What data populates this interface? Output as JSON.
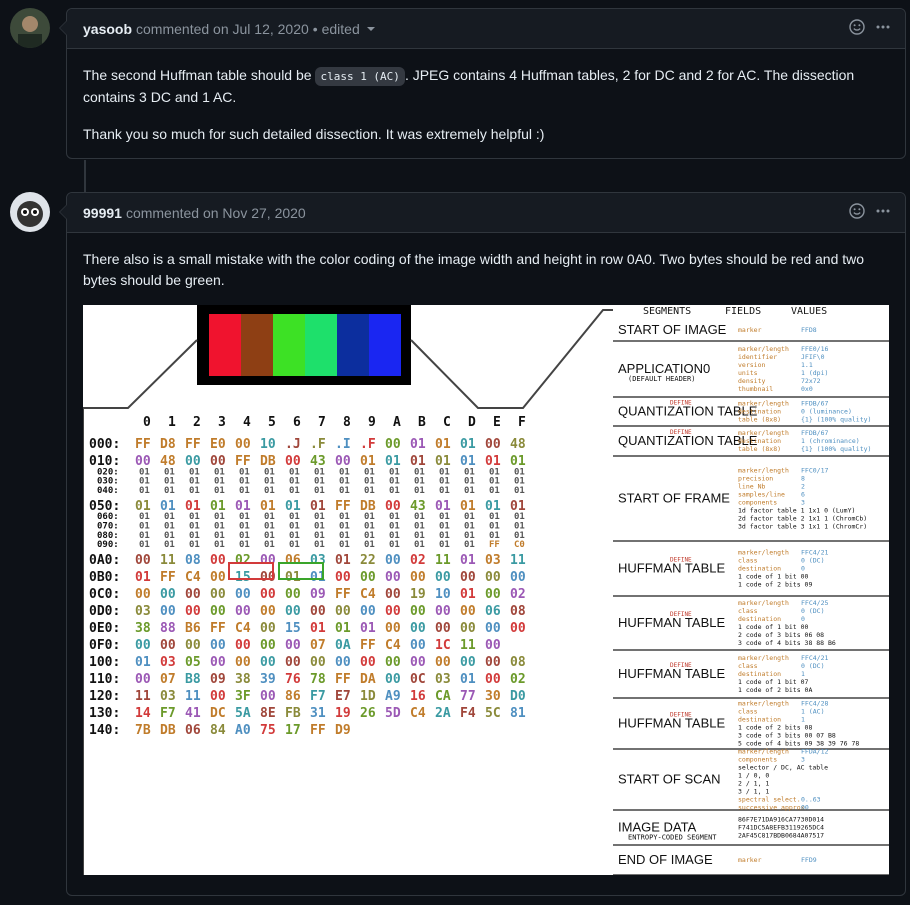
{
  "comments": [
    {
      "author": "yasoob",
      "meta": "commented on Jul 12, 2020",
      "edited": "• edited",
      "body_pre": "The second Huffman table should be ",
      "code": "class 1 (AC)",
      "body_post": ". JPEG contains 4 Huffman tables, 2 for DC and 2 for AC. The dissection contains 3 DC and 1 AC.",
      "body2": "Thank you so much for such detailed dissection. It was extremely helpful :)"
    },
    {
      "author": "99991",
      "meta": "commented on Nov 27, 2020",
      "body": "There also is a small mistake with the color coding of the image width and height in row 0A0. Two bytes should be red and two bytes should be green."
    }
  ],
  "icons": {
    "reaction": "smiley-icon",
    "menu": "kebab-icon"
  },
  "figure": {
    "headers": {
      "segments": "SEGMENTS",
      "fields": "FIELDS",
      "values": "VALUES"
    },
    "swatches": [
      "#f0132e",
      "#8e3f14",
      "#3de125",
      "#1ee06b",
      "#0c2e9e",
      "#1a26f2"
    ],
    "col_header": [
      "0",
      "1",
      "2",
      "3",
      "4",
      "5",
      "6",
      "7",
      "8",
      "9",
      "A",
      "B",
      "C",
      "D",
      "E",
      "F"
    ],
    "rows": [
      {
        "a": "000:",
        "b": [
          "FF",
          "D8",
          "FF",
          "E0",
          "00",
          "10",
          ".J",
          ".F",
          ".I",
          ".F",
          "00",
          "01",
          "01",
          "01",
          "00",
          "48"
        ],
        "big": true
      },
      {
        "a": "010:",
        "b": [
          "00",
          "48",
          "00",
          "00",
          "FF",
          "DB",
          "00",
          "43",
          "00",
          "01",
          "01",
          "01",
          "01",
          "01",
          "01",
          "01"
        ],
        "big": true
      },
      {
        "a": "020:",
        "b": [
          "01",
          "01",
          "01",
          "01",
          "01",
          "01",
          "01",
          "01",
          "01",
          "01",
          "01",
          "01",
          "01",
          "01",
          "01",
          "01"
        ],
        "big": false
      },
      {
        "a": "030:",
        "b": [
          "01",
          "01",
          "01",
          "01",
          "01",
          "01",
          "01",
          "01",
          "01",
          "01",
          "01",
          "01",
          "01",
          "01",
          "01",
          "01"
        ],
        "big": false
      },
      {
        "a": "040:",
        "b": [
          "01",
          "01",
          "01",
          "01",
          "01",
          "01",
          "01",
          "01",
          "01",
          "01",
          "01",
          "01",
          "01",
          "01",
          "01",
          "01"
        ],
        "big": false
      },
      {
        "a": "050:",
        "b": [
          "01",
          "01",
          "01",
          "01",
          "01",
          "01",
          "01",
          "01",
          "FF",
          "DB",
          "00",
          "43",
          "01",
          "01",
          "01",
          "01"
        ],
        "big": true
      },
      {
        "a": "060:",
        "b": [
          "01",
          "01",
          "01",
          "01",
          "01",
          "01",
          "01",
          "01",
          "01",
          "01",
          "01",
          "01",
          "01",
          "01",
          "01",
          "01"
        ],
        "big": false
      },
      {
        "a": "070:",
        "b": [
          "01",
          "01",
          "01",
          "01",
          "01",
          "01",
          "01",
          "01",
          "01",
          "01",
          "01",
          "01",
          "01",
          "01",
          "01",
          "01"
        ],
        "big": false
      },
      {
        "a": "080:",
        "b": [
          "01",
          "01",
          "01",
          "01",
          "01",
          "01",
          "01",
          "01",
          "01",
          "01",
          "01",
          "01",
          "01",
          "01",
          "01",
          "01"
        ],
        "big": false
      },
      {
        "a": "090:",
        "b": [
          "01",
          "01",
          "01",
          "01",
          "01",
          "01",
          "01",
          "01",
          "01",
          "01",
          "01",
          "01",
          "01",
          "01",
          "FF",
          "C0"
        ],
        "big": false
      },
      {
        "a": "0A0:",
        "b": [
          "00",
          "11",
          "08",
          "00",
          "02",
          "00",
          "06",
          "03",
          "01",
          "22",
          "00",
          "02",
          "11",
          "01",
          "03",
          "11"
        ],
        "big": true
      },
      {
        "a": "0B0:",
        "b": [
          "01",
          "FF",
          "C4",
          "00",
          "15",
          "00",
          "01",
          "01",
          "00",
          "00",
          "00",
          "00",
          "00",
          "00",
          "00",
          "00"
        ],
        "big": true
      },
      {
        "a": "0C0:",
        "b": [
          "00",
          "00",
          "00",
          "00",
          "00",
          "00",
          "00",
          "09",
          "FF",
          "C4",
          "00",
          "19",
          "10",
          "01",
          "00",
          "02"
        ],
        "big": true
      },
      {
        "a": "0D0:",
        "b": [
          "03",
          "00",
          "00",
          "00",
          "00",
          "00",
          "00",
          "00",
          "00",
          "00",
          "00",
          "00",
          "00",
          "00",
          "06",
          "08"
        ],
        "big": true
      },
      {
        "a": "0E0:",
        "b": [
          "38",
          "88",
          "B6",
          "FF",
          "C4",
          "00",
          "15",
          "01",
          "01",
          "01",
          "00",
          "00",
          "00",
          "00",
          "00",
          "00"
        ],
        "big": true
      },
      {
        "a": "0F0:",
        "b": [
          "00",
          "00",
          "00",
          "00",
          "00",
          "00",
          "00",
          "07",
          "0A",
          "FF",
          "C4",
          "00",
          "1C",
          "11",
          "00",
          ""
        ],
        "big": true
      },
      {
        "a": "100:",
        "b": [
          "01",
          "03",
          "05",
          "00",
          "00",
          "00",
          "00",
          "00",
          "00",
          "00",
          "00",
          "00",
          "00",
          "00",
          "00",
          "08"
        ],
        "big": true
      },
      {
        "a": "110:",
        "b": [
          "00",
          "07",
          "B8",
          "09",
          "38",
          "39",
          "76",
          "78",
          "FF",
          "DA",
          "00",
          "0C",
          "03",
          "01",
          "00",
          "02"
        ],
        "big": true
      },
      {
        "a": "120:",
        "b": [
          "11",
          "03",
          "11",
          "00",
          "3F",
          "00",
          "86",
          "F7",
          "E7",
          "1D",
          "A9",
          "16",
          "CA",
          "77",
          "30",
          "D0"
        ],
        "big": true
      },
      {
        "a": "130:",
        "b": [
          "14",
          "F7",
          "41",
          "DC",
          "5A",
          "8E",
          "FB",
          "31",
          "19",
          "26",
          "5D",
          "C4",
          "2A",
          "F4",
          "5C",
          "81"
        ],
        "big": true
      },
      {
        "a": "140:",
        "b": [
          "7B",
          "DB",
          "06",
          "84",
          "A0",
          "75",
          "17",
          "FF",
          "D9",
          "",
          "",
          "",
          "",
          "",
          "",
          ""
        ],
        "big": true
      }
    ],
    "segments": [
      {
        "name": "START OF IMAGE",
        "fields": [
          {
            "f": "marker",
            "v": "FFD8"
          }
        ]
      },
      {
        "pre": "",
        "name": "APPLICATION0",
        "sub": "(DEFAULT HEADER)",
        "fields": [
          {
            "f": "marker/length",
            "v": "FFE0/16"
          },
          {
            "f": "identifier",
            "v": "JFIF\\0"
          },
          {
            "f": "version",
            "v": "1.1"
          },
          {
            "f": "units",
            "v": "1 (dpi)"
          },
          {
            "f": "density",
            "v": "72x72"
          },
          {
            "f": "thumbnail",
            "v": "0x0"
          }
        ]
      },
      {
        "pre": "DEFINE",
        "name": "QUANTIZATION TABLE",
        "fields": [
          {
            "f": "marker/length",
            "v": "FFDB/67"
          },
          {
            "f": "destination",
            "v": "0 (luminance)"
          },
          {
            "f": "table (8x8)",
            "v": "{1} (100% quality)"
          }
        ]
      },
      {
        "pre": "DEFINE",
        "name": "QUANTIZATION TABLE",
        "fields": [
          {
            "f": "marker/length",
            "v": "FFDB/67"
          },
          {
            "f": "destination",
            "v": "1 (chrominance)"
          },
          {
            "f": "table (8x8)",
            "v": "{1} (100% quality)"
          }
        ]
      },
      {
        "name": "START OF FRAME",
        "fields": [
          {
            "f": "marker/length",
            "v": "FFC0/17"
          },
          {
            "f": "precision",
            "v": "8"
          },
          {
            "f": "line Nb",
            "v": "2"
          },
          {
            "f": "samples/line",
            "v": "6"
          },
          {
            "f": "components",
            "v": "3"
          },
          {
            "f": "",
            "v": "1d factor table 1 1x1 0 (LumY)"
          },
          {
            "f": "",
            "v": "2d factor table 2 1x1 1 (ChromCb)"
          },
          {
            "f": "",
            "v": "3d factor table 3 1x1 1 (ChromCr)"
          }
        ]
      },
      {
        "pre": "DEFINE",
        "name": "HUFFMAN TABLE",
        "fields": [
          {
            "f": "marker/length",
            "v": "FFC4/21"
          },
          {
            "f": "class",
            "v": "0 (DC)"
          },
          {
            "f": "destination",
            "v": "0"
          },
          {
            "f": "",
            "v": "1 code of 1 bit 00"
          },
          {
            "f": "",
            "v": "1 code of 2 bits 09"
          }
        ]
      },
      {
        "pre": "DEFINE",
        "name": "HUFFMAN TABLE",
        "fields": [
          {
            "f": "marker/length",
            "v": "FFC4/25"
          },
          {
            "f": "class",
            "v": "0 (DC)"
          },
          {
            "f": "destination",
            "v": "0"
          },
          {
            "f": "",
            "v": "1 code of 1 bit 00"
          },
          {
            "f": "",
            "v": "2 code of 3 bits 06 08"
          },
          {
            "f": "",
            "v": "3 code of 4 bits 38 88 B6"
          }
        ]
      },
      {
        "pre": "DEFINE",
        "name": "HUFFMAN TABLE",
        "fields": [
          {
            "f": "marker/length",
            "v": "FFC4/21"
          },
          {
            "f": "class",
            "v": "0 (DC)"
          },
          {
            "f": "destination",
            "v": "1"
          },
          {
            "f": "",
            "v": "1 code of 1 bit 07"
          },
          {
            "f": "",
            "v": "1 code of 2 bits 0A"
          }
        ]
      },
      {
        "pre": "DEFINE",
        "name": "HUFFMAN TABLE",
        "fields": [
          {
            "f": "marker/length",
            "v": "FFC4/28"
          },
          {
            "f": "class",
            "v": "1 (AC)"
          },
          {
            "f": "destination",
            "v": "1"
          },
          {
            "f": "",
            "v": "1 code of 2 bits 08"
          },
          {
            "f": "",
            "v": "3 code of 3 bits 00 07 B8"
          },
          {
            "f": "",
            "v": "5 code of 4 bits 09 38 39 76 78"
          }
        ]
      },
      {
        "name": "START OF SCAN",
        "fields": [
          {
            "f": "marker/length",
            "v": "FFDA/12"
          },
          {
            "f": "components",
            "v": "3"
          },
          {
            "f": "",
            "v": "selector / DC, AC table"
          },
          {
            "f": "",
            "v": "1 / 0, 0"
          },
          {
            "f": "",
            "v": "2 / 1, 1"
          },
          {
            "f": "",
            "v": "3 / 1, 1"
          },
          {
            "f": "spectral select.",
            "v": "0..63"
          },
          {
            "f": "successive approx.",
            "v": "00"
          }
        ]
      },
      {
        "name": "IMAGE DATA",
        "sub": "ENTROPY-CODED SEGMENT",
        "fields": [
          {
            "f": "",
            "v": "86F7E71DA916CA7730D014"
          },
          {
            "f": "",
            "v": "F741DC5A8EFB3119265DC4"
          },
          {
            "f": "",
            "v": "2AF45C817BDB0684A07517"
          }
        ]
      },
      {
        "name": "END OF IMAGE",
        "fields": [
          {
            "f": "marker",
            "v": "FFD9"
          }
        ]
      }
    ]
  }
}
